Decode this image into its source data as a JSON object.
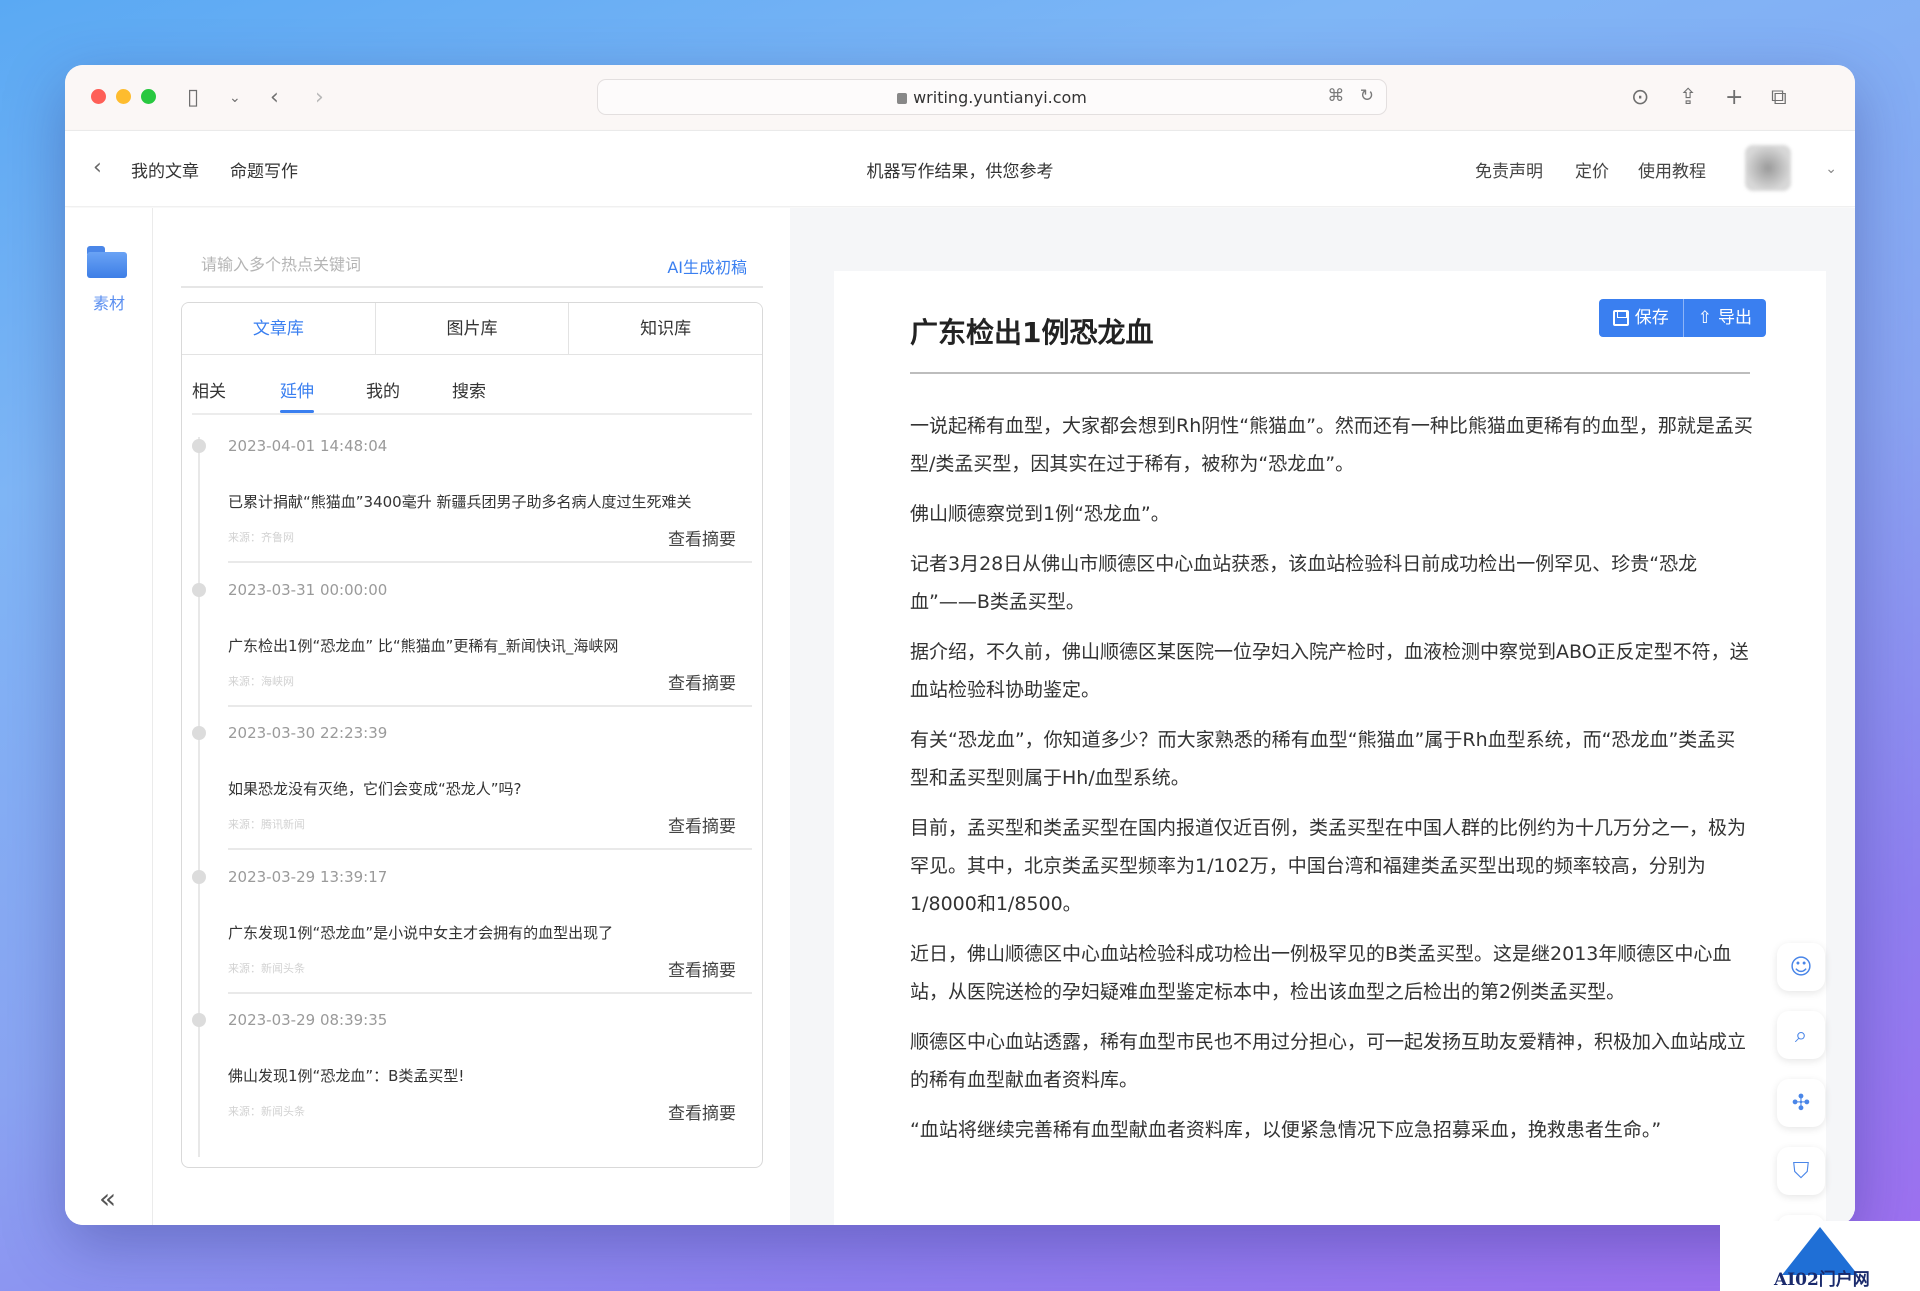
{
  "browser": {
    "url": "writing.yuntianyi.com"
  },
  "header": {
    "nav_my_articles": "我的文章",
    "nav_topic_writing": "命题写作",
    "center_notice": "机器写作结果，供您参考",
    "nav_disclaimer": "免责声明",
    "nav_pricing": "定价",
    "nav_tutorial": "使用教程"
  },
  "left_rail": {
    "materials_label": "素材"
  },
  "keywords": {
    "placeholder": "请输入多个热点关键词",
    "ai_button": "AI生成初稿"
  },
  "library_tabs": [
    "文章库",
    "图片库",
    "知识库"
  ],
  "library_active": "文章库",
  "sub_tabs": [
    "相关",
    "延伸",
    "我的",
    "搜索"
  ],
  "sub_active": "延伸",
  "articles": [
    {
      "date": "2023-04-01 14:48:04",
      "title": "已累计捐献“熊猫血”3400毫升 新疆兵团男子助多名病人度过生死难关",
      "source": "来源：齐鲁网",
      "summary": "查看摘要"
    },
    {
      "date": "2023-03-31 00:00:00",
      "title": "广东检出1例“恐龙血” 比“熊猫血”更稀有_新闻快讯_海峡网",
      "source": "来源：海峡网",
      "summary": "查看摘要"
    },
    {
      "date": "2023-03-30 22:23:39",
      "title": "如果恐龙没有灭绝，它们会变成“恐龙人”吗?",
      "source": "来源：腾讯新闻",
      "summary": "查看摘要"
    },
    {
      "date": "2023-03-29 13:39:17",
      "title": "广东发现1例“恐龙血”是小说中女主才会拥有的血型出现了",
      "source": "来源：新闻头条",
      "summary": "查看摘要"
    },
    {
      "date": "2023-03-29 08:39:35",
      "title": "佛山发现1例“恐龙血”：B类孟买型!",
      "source": "来源：新闻头条",
      "summary": "查看摘要"
    }
  ],
  "document": {
    "title": "广东检出1例恐龙血",
    "save_label": "保存",
    "export_label": "导出",
    "paragraphs": [
      "一说起稀有血型，大家都会想到Rh阴性“熊猫血”。然而还有一种比熊猫血更稀有的血型，那就是孟买型/类孟买型，因其实在过于稀有，被称为“恐龙血”。",
      "佛山顺德察觉到1例“恐龙血”。",
      "记者3月28日从佛山市顺德区中心血站获悉，该血站检验科日前成功检出一例罕见、珍贵“恐龙血”——B类孟买型。",
      "据介绍，不久前，佛山顺德区某医院一位孕妇入院产检时，血液检测中察觉到ABO正反定型不符，送血站检验科协助鉴定。",
      "有关“恐龙血”，你知道多少？而大家熟悉的稀有血型“熊猫血”属于Rh血型系统，而“恐龙血”类孟买型和孟买型则属于Hh/血型系统。",
      "目前，孟买型和类孟买型在国内报道仅近百例，类孟买型在中国人群的比例约为十几万分之一，极为罕见。其中，北京类孟买型频率为1/102万，中国台湾和福建类孟买型出现的频率较高，分别为1/8000和1/8500。",
      "近日，佛山顺德区中心血站检验科成功检出一例极罕见的B类孟买型。这是继2013年顺德区中心血站，从医院送检的孕妇疑难血型鉴定标本中，检出该血型之后检出的第2例类孟买型。",
      "顺德区中心血站透露，稀有血型市民也不用过分担心，可一起发扬互助友爱精神，积极加入血站成立的稀有血型献血者资料库。",
      "“血站将继续完善稀有血型献血者资料库，以便紧急情况下应急招募采血，挽救患者生命。”"
    ]
  },
  "side_tools": [
    "robot-icon",
    "search-icon",
    "network-icon",
    "shield-alert-icon",
    "text-box-icon",
    "comment-icon"
  ],
  "watermark": {
    "text": "AI02门户网"
  },
  "colors": {
    "accent": "#3a7ff0",
    "traffic_red": "#fe5f57",
    "traffic_yellow": "#febc2e",
    "traffic_green": "#28c840"
  }
}
